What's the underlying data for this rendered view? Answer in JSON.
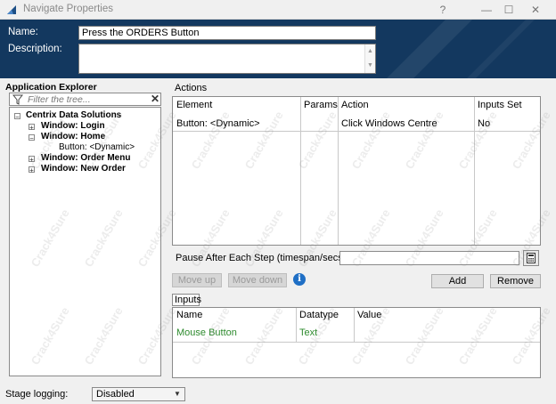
{
  "window": {
    "title": "Navigate Properties",
    "help_glyph": "?",
    "minimize_glyph": "—",
    "maximize_glyph": "☐",
    "close_glyph": "✕"
  },
  "header": {
    "name_label": "Name:",
    "name_value": "Press the ORDERS Button",
    "description_label": "Description:",
    "description_value": ""
  },
  "explorer": {
    "title": "Application Explorer",
    "filter_placeholder": "Filter the tree...",
    "tree": {
      "root": "Centrix Data Solutions",
      "items": [
        {
          "label": "Window: Login",
          "expanded": false
        },
        {
          "label": "Window: Home",
          "expanded": true,
          "children": [
            "Button: <Dynamic>"
          ]
        },
        {
          "label": "Window: Order Menu",
          "expanded": false
        },
        {
          "label": "Window: New Order",
          "expanded": false
        }
      ]
    }
  },
  "actions": {
    "title": "Actions",
    "columns": [
      "Element",
      "Params",
      "Action",
      "Inputs Set"
    ],
    "rows": [
      {
        "element": "Button: <Dynamic>",
        "params": "",
        "action": "Click Windows Centre",
        "inputs_set": "No"
      }
    ],
    "pause_label": "Pause After Each Step (timespan/secs)",
    "pause_value": "",
    "move_up_label": "Move up",
    "move_down_label": "Move down",
    "add_label": "Add",
    "remove_label": "Remove"
  },
  "inputs": {
    "title": "Inputs",
    "columns": [
      "Name",
      "Datatype",
      "Value"
    ],
    "rows": [
      {
        "name": "Mouse Button",
        "datatype": "Text",
        "value": ""
      }
    ]
  },
  "stage_logging": {
    "label": "Stage logging:",
    "value": "Disabled"
  },
  "watermark": "Crack4Sure",
  "colors": {
    "header_bg": "#13385f",
    "green_text": "#2e8b2e",
    "info_blue": "#1f6fc5"
  }
}
